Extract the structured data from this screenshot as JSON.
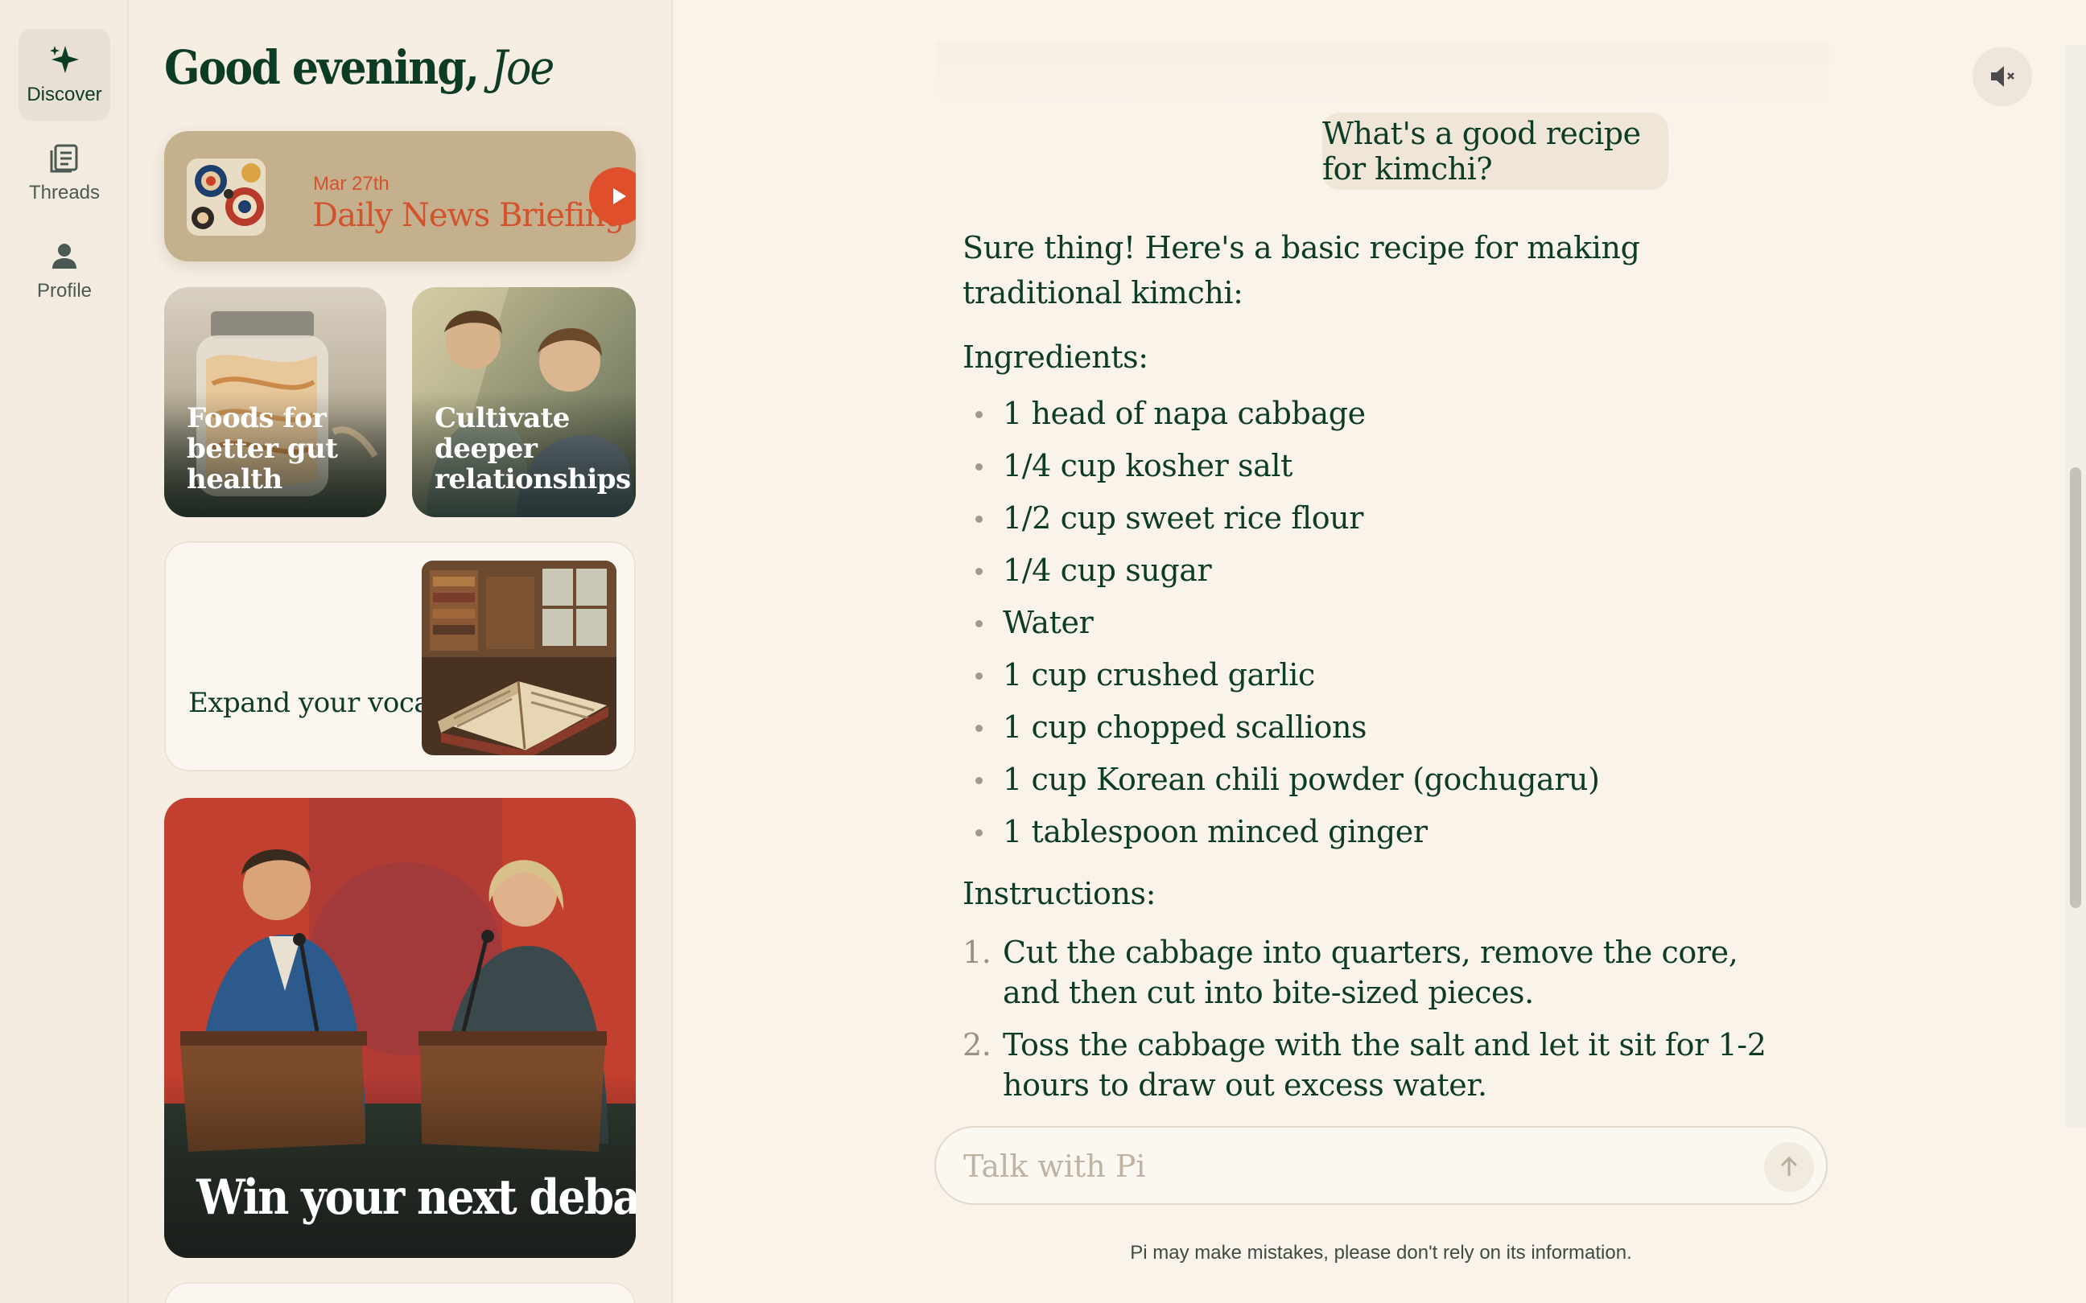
{
  "nav": {
    "items": [
      {
        "label": "Discover",
        "icon": "sparkle-icon",
        "active": true
      },
      {
        "label": "Threads",
        "icon": "threads-icon",
        "active": false
      },
      {
        "label": "Profile",
        "icon": "person-icon",
        "active": false
      }
    ]
  },
  "discover": {
    "greeting_prefix": "Good evening,",
    "greeting_name": "Joe",
    "news": {
      "date": "Mar 27th",
      "title": "Daily News Briefing"
    },
    "cards": {
      "gut": "Foods for better gut health",
      "relationships": "Cultivate deeper relationships",
      "vocabulary": "Expand your vocabulary",
      "debate": "Win your next debate"
    }
  },
  "chat": {
    "user_message": "What's a good recipe for kimchi?",
    "response": {
      "intro": "Sure thing! Here's a basic recipe for making traditional kimchi:",
      "ingredients_heading": "Ingredients:",
      "ingredients": [
        "1 head of napa cabbage",
        "1/4 cup kosher salt",
        "1/2 cup sweet rice flour",
        "1/4 cup sugar",
        "Water",
        "1 cup crushed garlic",
        "1 cup chopped scallions",
        "1 cup Korean chili powder (gochugaru)",
        "1 tablespoon minced ginger"
      ],
      "instructions_heading": "Instructions:",
      "steps": [
        {
          "num": "1.",
          "text": "Cut the cabbage into quarters, remove the core, and then cut into bite-sized pieces."
        },
        {
          "num": "2.",
          "text": "Toss the cabbage with the salt and let it sit for 1-2 hours to draw out excess water."
        }
      ]
    },
    "input_placeholder": "Talk with Pi",
    "disclaimer": "Pi may make mistakes, please don't rely on its information."
  },
  "colors": {
    "accent": "#e04f2c",
    "text": "#0d3c26",
    "background": "#faf3ea"
  }
}
